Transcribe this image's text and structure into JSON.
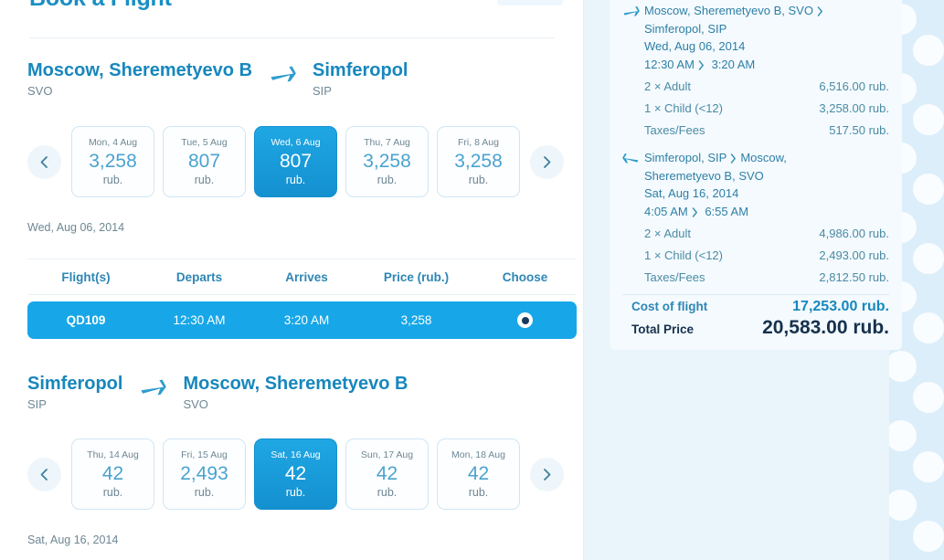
{
  "page": {
    "title": "Book a Flight"
  },
  "outbound": {
    "from_city": "Moscow, Sheremetyevo B",
    "from_code": "SVO",
    "to_city": "Simferopol",
    "to_code": "SIP",
    "plane_icon": "plane-right-icon",
    "prev_icon": "chevron-left-icon",
    "next_icon": "chevron-right-icon",
    "days": [
      {
        "dow": "Mon, 4 Aug",
        "amount": "3,258",
        "currency": "rub.",
        "selected": false
      },
      {
        "dow": "Tue, 5 Aug",
        "amount": "807",
        "currency": "rub.",
        "selected": false
      },
      {
        "dow": "Wed, 6 Aug",
        "amount": "807",
        "currency": "rub.",
        "selected": true
      },
      {
        "dow": "Thu, 7 Aug",
        "amount": "3,258",
        "currency": "rub.",
        "selected": false
      },
      {
        "dow": "Fri, 8 Aug",
        "amount": "3,258",
        "currency": "rub.",
        "selected": false
      }
    ],
    "selected_date": "Wed, Aug 06, 2014",
    "table": {
      "headers": [
        "Flight(s)",
        "Departs",
        "Arrives",
        "Price (rub.)",
        "Choose"
      ],
      "rows": [
        {
          "flight": "QD109",
          "departs": "12:30 AM",
          "arrives": "3:20 AM",
          "price": "3,258",
          "chosen": true
        }
      ]
    }
  },
  "inbound": {
    "from_city": "Simferopol",
    "from_code": "SIP",
    "to_city": "Moscow, Sheremetyevo B",
    "to_code": "SVO",
    "plane_icon": "plane-right-icon",
    "prev_icon": "chevron-left-icon",
    "next_icon": "chevron-right-icon",
    "days": [
      {
        "dow": "Thu, 14 Aug",
        "amount": "42",
        "currency": "rub.",
        "selected": false
      },
      {
        "dow": "Fri, 15 Aug",
        "amount": "2,493",
        "currency": "rub.",
        "selected": false
      },
      {
        "dow": "Sat, 16 Aug",
        "amount": "42",
        "currency": "rub.",
        "selected": true
      },
      {
        "dow": "Sun, 17 Aug",
        "amount": "42",
        "currency": "rub.",
        "selected": false
      },
      {
        "dow": "Mon, 18 Aug",
        "amount": "42",
        "currency": "rub.",
        "selected": false
      }
    ],
    "selected_date": "Sat, Aug 16, 2014"
  },
  "summary": {
    "legs": [
      {
        "icon": "plane-right-icon",
        "line1_a": "Moscow, Sheremetyevo B, SVO",
        "line1_sep": "chevron-right-icon",
        "line2": "Simferopol, SIP",
        "line3": "Wed, Aug 06, 2014",
        "time_dep": "12:30 AM",
        "time_sep": "chevron-right-icon",
        "time_arr": "3:20 AM",
        "prices": [
          {
            "label": "2 × Adult",
            "value": "6,516.00 rub."
          },
          {
            "label": "1 × Child (<12)",
            "value": "3,258.00 rub."
          },
          {
            "label": "Taxes/Fees",
            "value": "517.50 rub."
          }
        ]
      },
      {
        "icon": "plane-left-icon",
        "line1_a": "Simferopol, SIP",
        "line1_sep": "chevron-right-icon",
        "line1_b": "Moscow,",
        "line2": "Sheremetyevo B, SVO",
        "line3": "Sat, Aug 16, 2014",
        "time_dep": "4:05 AM",
        "time_sep": "chevron-right-icon",
        "time_arr": "6:55 AM",
        "prices": [
          {
            "label": "2 × Adult",
            "value": "4,986.00 rub."
          },
          {
            "label": "1 × Child (<12)",
            "value": "2,493.00 rub."
          },
          {
            "label": "Taxes/Fees",
            "value": "2,812.50 rub."
          }
        ]
      }
    ],
    "cost_label": "Cost of flight",
    "cost_value": "17,253.00 rub.",
    "total_label": "Total Price",
    "total_value": "20,583.00 rub."
  },
  "colors": {
    "accent": "#17a7e8",
    "heading": "#1787bd",
    "muted": "#6d8794",
    "dark": "#17314d",
    "panel": "#f4fafe",
    "backdrop": "#dceefa"
  }
}
